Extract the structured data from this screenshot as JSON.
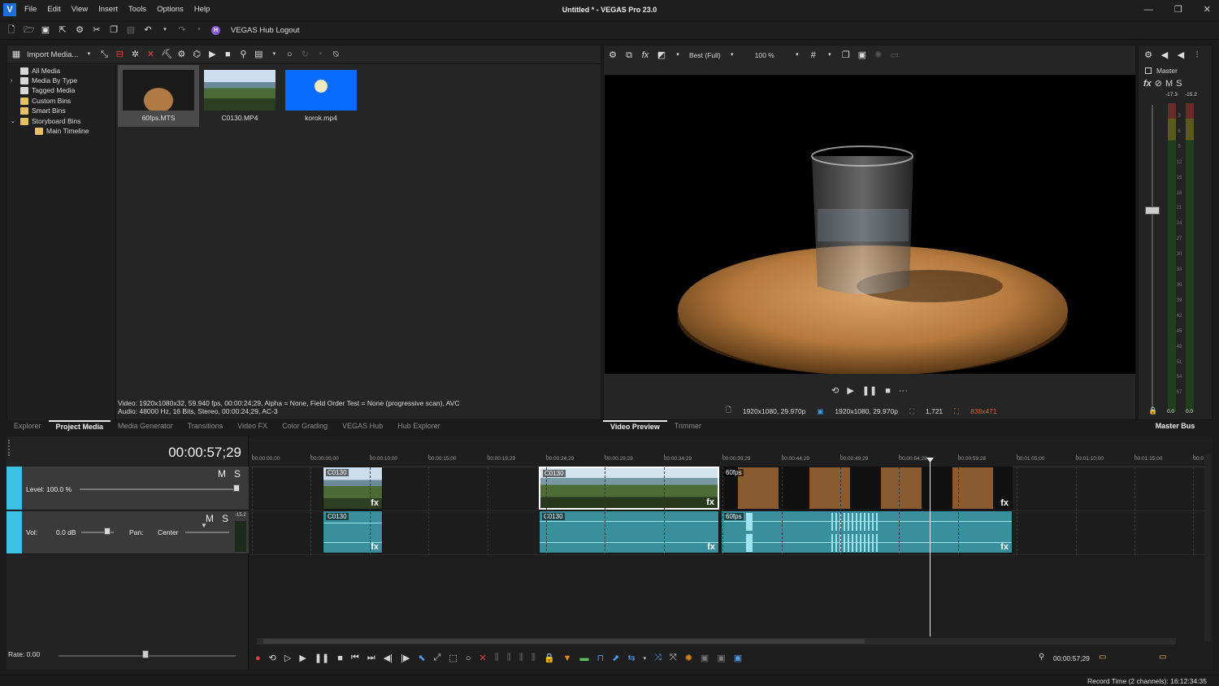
{
  "app": {
    "logo": "V",
    "title": "Untitled * - VEGAS Pro 23.0",
    "menu": [
      "File",
      "Edit",
      "View",
      "Insert",
      "Tools",
      "Options",
      "Help"
    ],
    "window_controls": [
      "—",
      "❐",
      "✕"
    ]
  },
  "main_toolbar": {
    "hub_logout": "VEGAS Hub Logout",
    "hub_icon": "H"
  },
  "project_media": {
    "import_label": "Import Media...",
    "tree": [
      {
        "label": "All Media",
        "icon": "media-folder-icon"
      },
      {
        "label": "Media By Type",
        "icon": "media-folder-icon"
      },
      {
        "label": "Tagged Media",
        "icon": "media-folder-icon"
      },
      {
        "label": "Custom Bins",
        "icon": "folder-icon"
      },
      {
        "label": "Smart Bins",
        "icon": "folder-icon"
      },
      {
        "label": "Storyboard Bins",
        "icon": "folder-icon"
      },
      {
        "label": "Main Timeline",
        "icon": "folder-icon"
      }
    ],
    "thumbnails": [
      {
        "label": "60fps.MTS",
        "selected": true
      },
      {
        "label": "C0130.MP4",
        "selected": false
      },
      {
        "label": "korok.mp4",
        "selected": false
      }
    ],
    "info_video": "Video: 1920x1080x32, 59.940 fps, 00:00:24;29, Alpha = None, Field Order Test = None (progressive scan), AVC",
    "info_audio": "Audio: 48000 Hz, 16 Bits, Stereo, 00:00:24;29, AC-3"
  },
  "left_tabs": [
    "Explorer",
    "Project Media",
    "Media Generator",
    "Transitions",
    "Video FX",
    "Color Grading",
    "VEGAS Hub",
    "Hub Explorer"
  ],
  "left_tab_active": "Project Media",
  "preview": {
    "quality": "Best (Full)",
    "zoom": "100 %",
    "project_res": "1920x1080, 29.970p",
    "preview_res": "1920x1080, 29.970p",
    "frame": "1,721",
    "display_size": "838x471",
    "display_size_color": "#e05a3a"
  },
  "mid_tabs": [
    "Video Preview",
    "Trimmer"
  ],
  "mid_tab_active": "Video Preview",
  "master": {
    "label": "Master",
    "m": "M",
    "s": "S",
    "peak_left": "-17.3",
    "peak_right": "-15.2",
    "scale": [
      "3",
      "6",
      "9",
      "12",
      "15",
      "18",
      "21",
      "24",
      "27",
      "30",
      "33",
      "36",
      "39",
      "42",
      "45",
      "48",
      "51",
      "54",
      "57"
    ],
    "bottom_left": "0.0",
    "bottom_right": "0.0",
    "tab": "Master Bus"
  },
  "timeline": {
    "timecode": "00:00:57;29",
    "video_track": {
      "level_label": "Level:",
      "level_value": "100.0 %",
      "m": "M",
      "s": "S"
    },
    "audio_track": {
      "vol_label": "Vol:",
      "vol_value": "0.0 dB",
      "pan_label": "Pan:",
      "pan_value": "Center",
      "m": "M",
      "s": "S",
      "peak": "-15.2"
    },
    "ruler": [
      "00:00:00;00",
      "00:00:05;00",
      "00:00:10;00",
      "00:00:15;00",
      "00:00:19;29",
      "00:00:24;29",
      "00:00:29;29",
      "00:00:34;29",
      "00:00:39;29",
      "00:00:44;29",
      "00:00:49;29",
      "00:00:54;29",
      "00:00:59;28",
      "00:01:05;00",
      "00:01:10;00",
      "00:01:15;00",
      "00:0"
    ],
    "clips": {
      "v1": "C0130",
      "v2": "C0130",
      "v3": "60fps",
      "a1": "C0130",
      "a2": "C0130",
      "a3": "60fps",
      "fx": "fx",
      "more": "···"
    },
    "rate": "Rate: 0.00",
    "end_time": "00:00:57;29"
  },
  "status": {
    "record_time": "Record Time (2 channels): 16:12:34:35"
  }
}
